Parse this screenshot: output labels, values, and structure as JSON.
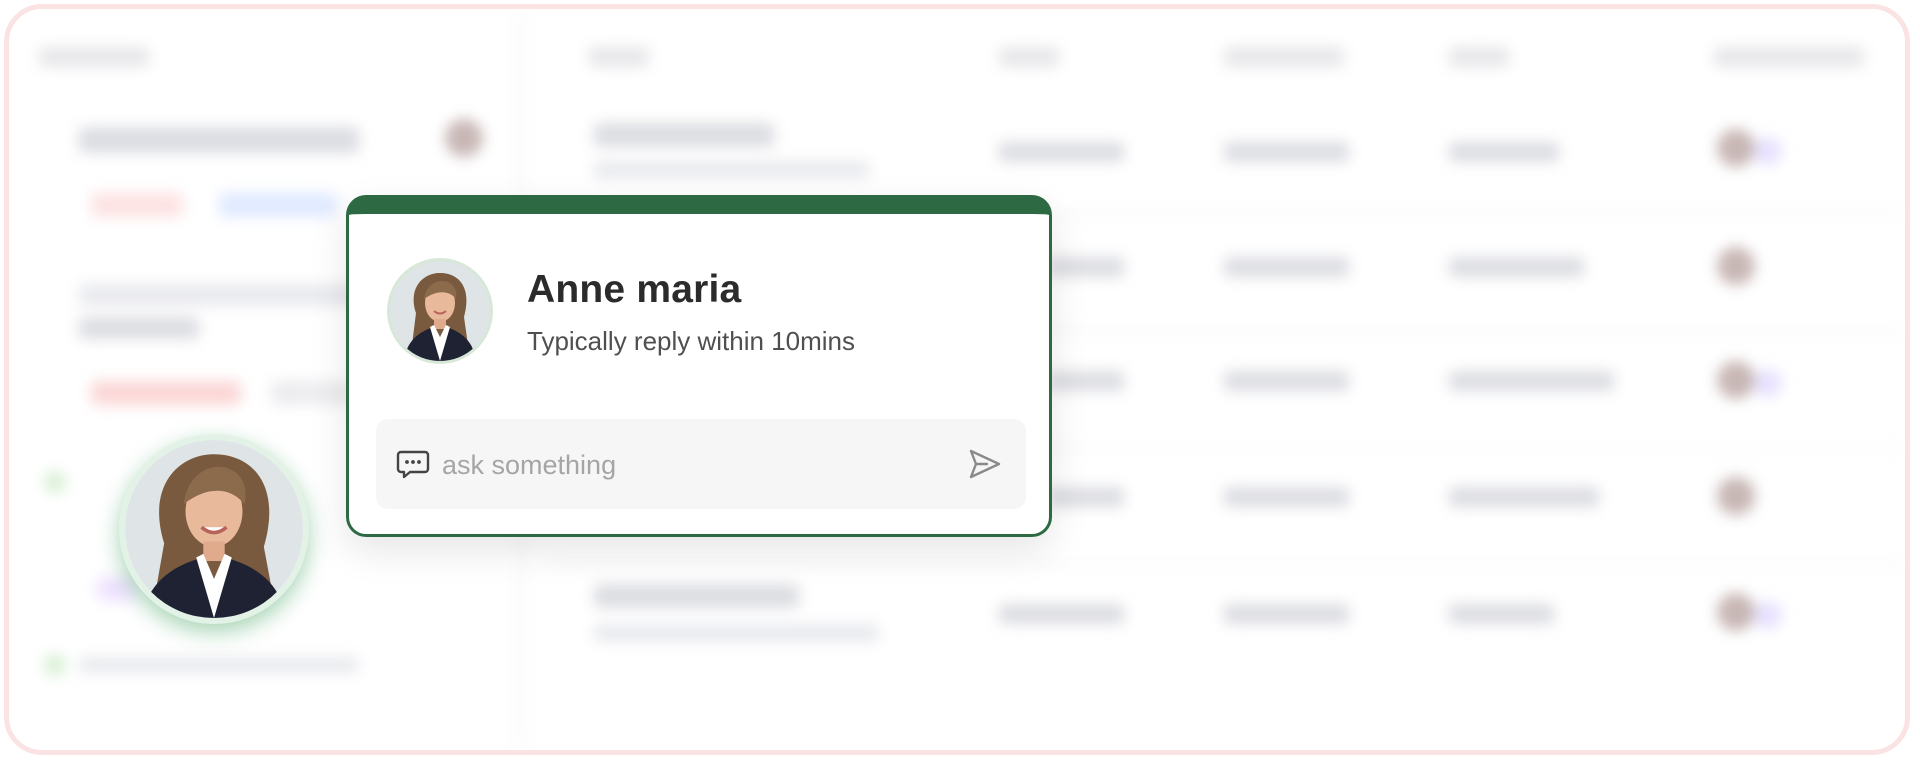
{
  "chat": {
    "agent_name": "Anne maria",
    "reply_time": "Typically reply within 10mins",
    "input_placeholder": "ask something",
    "accent_color": "#2d6a44"
  },
  "icons": {
    "chat": "chat-bubble-icon",
    "send": "send-icon"
  }
}
